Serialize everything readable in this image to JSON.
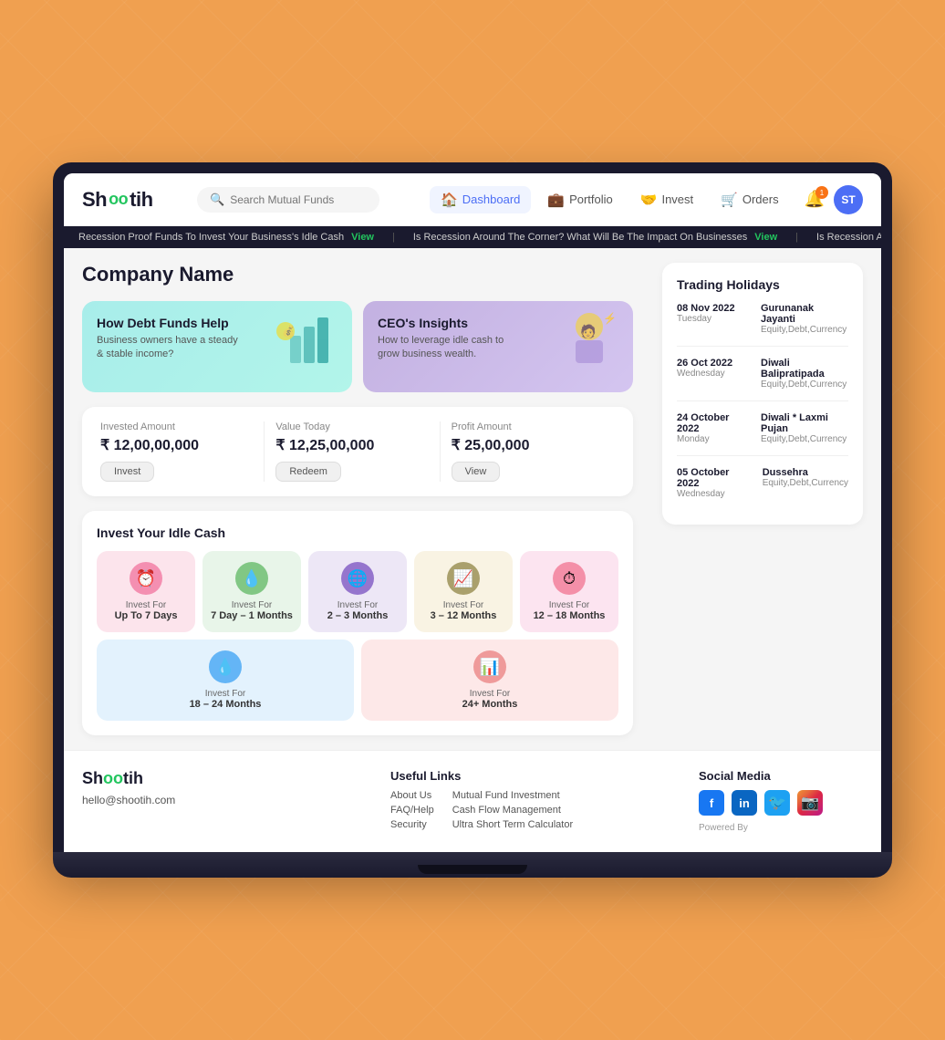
{
  "app": {
    "name": "Shootih",
    "logo_text": "Shoo↦tih"
  },
  "navbar": {
    "search_placeholder": "Search Mutual Funds",
    "links": [
      {
        "id": "dashboard",
        "label": "Dashboard",
        "icon": "🏠",
        "active": true
      },
      {
        "id": "portfolio",
        "label": "Portfolio",
        "icon": "💼",
        "active": false
      },
      {
        "id": "invest",
        "label": "Invest",
        "icon": "🤝",
        "active": false
      },
      {
        "id": "orders",
        "label": "Orders",
        "icon": "🛒",
        "active": false
      }
    ],
    "avatar_text": "ST"
  },
  "ticker": {
    "items": [
      {
        "text": "Recession Proof Funds To Invest Your Business's Idle Cash",
        "cta": "View"
      },
      {
        "text": "Is Recession Around The Corner? What Will Be The Impact On Businesses",
        "cta": "View"
      },
      {
        "text": "Is Recession Around The Corner? What Will Be The Impact On Bu...",
        "cta": ""
      }
    ]
  },
  "page": {
    "title": "Company Name"
  },
  "articles": [
    {
      "id": "debt-funds",
      "title": "How Debt Funds Help",
      "desc": "Business owners have a steady & stable income?",
      "color": "teal",
      "illustration": "📊"
    },
    {
      "id": "ceo-insights",
      "title": "CEO's Insights",
      "desc": "How to leverage idle cash to grow business wealth.",
      "color": "purple",
      "illustration": "💡"
    }
  ],
  "stats": [
    {
      "id": "invested",
      "label": "Invested Amount",
      "value": "₹ 12,00,00,000",
      "btn_label": "Invest"
    },
    {
      "id": "value",
      "label": "Value Today",
      "value": "₹ 12,25,00,000",
      "btn_label": "Redeem"
    },
    {
      "id": "profit",
      "label": "Profit Amount",
      "value": "₹ 25,00,000",
      "btn_label": "View"
    }
  ],
  "idle_cash": {
    "title": "Invest Your Idle Cash",
    "cards": [
      {
        "id": "up-to-7-days",
        "label_line1": "Invest For",
        "label_line2": "Up To 7 Days",
        "icon": "⏰",
        "color": "pink",
        "icon_color": "ic-pink"
      },
      {
        "id": "7day-1month",
        "label_line1": "Invest For",
        "label_line2": "7 Day – 1 Months",
        "icon": "💧",
        "color": "green",
        "icon_color": "ic-green"
      },
      {
        "id": "2-3months",
        "label_line1": "Invest For",
        "label_line2": "2 – 3 Months",
        "icon": "🌐",
        "color": "purple-light",
        "icon_color": "ic-purple"
      },
      {
        "id": "3-12months",
        "label_line1": "Invest For",
        "label_line2": "3 – 12 Months",
        "icon": "📈",
        "color": "yellow",
        "icon_color": "ic-yellow"
      },
      {
        "id": "12-18months",
        "label_line1": "Invest For",
        "label_line2": "12 – 18 Months",
        "icon": "⏱",
        "color": "pink2",
        "icon_color": "ic-pink2"
      },
      {
        "id": "18-24months",
        "label_line1": "Invest For",
        "label_line2": "18 – 24 Months",
        "icon": "💧",
        "color": "blue",
        "icon_color": "ic-blue"
      },
      {
        "id": "24plus-months",
        "label_line1": "Invest For",
        "label_line2": "24+ Months",
        "icon": "📊",
        "color": "pink3",
        "icon_color": "ic-red"
      }
    ]
  },
  "trading_holidays": {
    "title": "Trading Holidays",
    "items": [
      {
        "date": "08 Nov 2022",
        "day": "Tuesday",
        "name": "Gurunanak Jayanti",
        "type": "Equity,Debt,Currency"
      },
      {
        "date": "26 Oct 2022",
        "day": "Wednesday",
        "name": "Diwali Balipratipada",
        "type": "Equity,Debt,Currency"
      },
      {
        "date": "24 October 2022",
        "day": "Monday",
        "name": "Diwali * Laxmi Pujan",
        "type": "Equity,Debt,Currency"
      },
      {
        "date": "05 October 2022",
        "day": "Wednesday",
        "name": "Dussehra",
        "type": "Equity,Debt,Currency"
      }
    ]
  },
  "footer": {
    "brand": {
      "logo": "Shootih",
      "email": "hello@shootih.com"
    },
    "useful_links": {
      "title": "Useful Links",
      "col1": [
        "About Us",
        "FAQ/Help",
        "Security"
      ],
      "col2": [
        "Mutual Fund Investment",
        "Cash Flow Management",
        "Ultra Short Term Calculator"
      ]
    },
    "social_media": {
      "title": "Social Media",
      "icons": [
        "f",
        "in",
        "🐦",
        "📷"
      ],
      "powered_by": "Powered By"
    }
  }
}
